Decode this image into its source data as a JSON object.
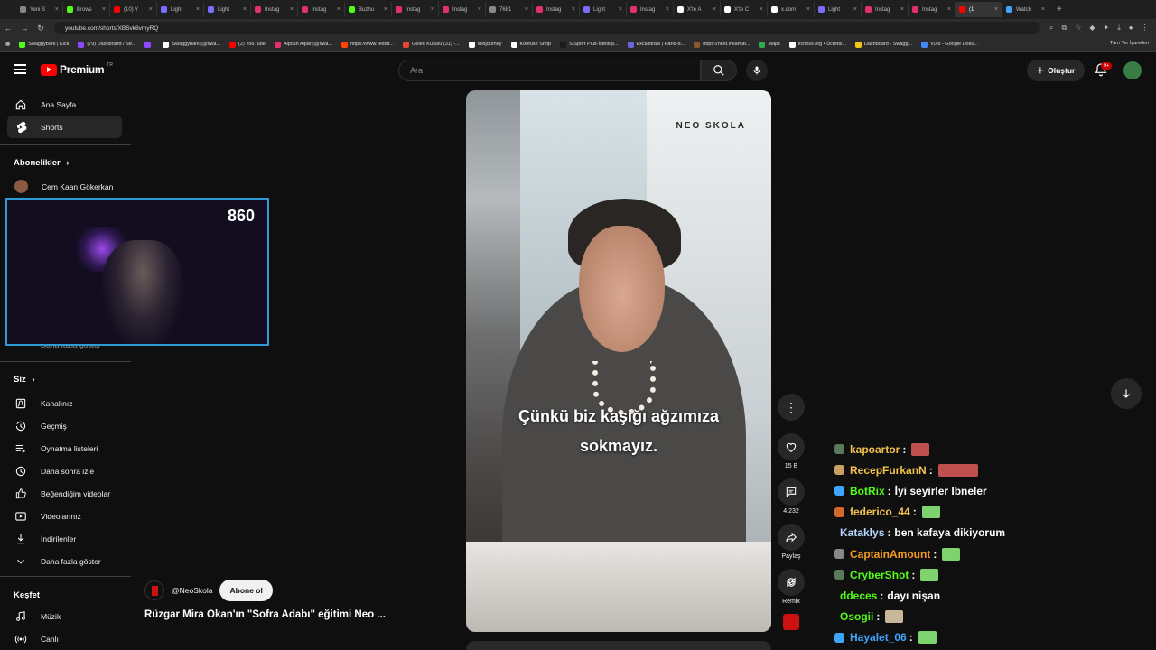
{
  "browser": {
    "tabs": [
      {
        "label": "Yeni S",
        "color": "#888888"
      },
      {
        "label": "Brows",
        "color": "#53fc18"
      },
      {
        "label": "(10) Y",
        "color": "#ff0000"
      },
      {
        "label": "Light",
        "color": "#7a6cff"
      },
      {
        "label": "Light",
        "color": "#7a6cff"
      },
      {
        "label": "Instag",
        "color": "#e1306c"
      },
      {
        "label": "Instag",
        "color": "#e1306c"
      },
      {
        "label": "Buzhu",
        "color": "#53fc18"
      },
      {
        "label": "Instag",
        "color": "#e1306c"
      },
      {
        "label": "Instag",
        "color": "#e1306c"
      },
      {
        "label": "7681",
        "color": "#888888"
      },
      {
        "label": "Instag",
        "color": "#e1306c"
      },
      {
        "label": "Light",
        "color": "#7a6cff"
      },
      {
        "label": "Instag",
        "color": "#e1306c"
      },
      {
        "label": "X'te A",
        "color": "#ffffff"
      },
      {
        "label": "X'te C",
        "color": "#ffffff"
      },
      {
        "label": "x.com",
        "color": "#ffffff"
      },
      {
        "label": "Light",
        "color": "#7a6cff"
      },
      {
        "label": "Instag",
        "color": "#e1306c"
      },
      {
        "label": "Instag",
        "color": "#e1306c"
      },
      {
        "label": "(1",
        "color": "#ff0000",
        "active": true
      },
      {
        "label": "Watch",
        "color": "#3ea6ff"
      }
    ],
    "url": "youtube.com/shorts/XBSvk8vmyRQ",
    "bookmarks": [
      {
        "label": "Swaggybark | Kick",
        "color": "#53fc18"
      },
      {
        "label": "(79) Dashboard / Str...",
        "color": "#9146ff"
      },
      {
        "label": "",
        "color": "#9146ff"
      },
      {
        "label": "Swaggybark (@swa...",
        "color": "#ffffff"
      },
      {
        "label": "(2) YouTube",
        "color": "#ff0000"
      },
      {
        "label": "Alpcan Alpar (@swa...",
        "color": "#e1306c"
      },
      {
        "label": "https://www.reddit...",
        "color": "#ff4500"
      },
      {
        "label": "Gelen Kutusu (31) -...",
        "color": "#ea4335"
      },
      {
        "label": "Midjourney",
        "color": "#ffffff"
      },
      {
        "label": "Konfuse Shop",
        "color": "#ffffff"
      },
      {
        "label": "S Sport Plus-İstediği...",
        "color": "#1a1a1a"
      },
      {
        "label": "Excalidraw | Hand-d...",
        "color": "#6965db"
      },
      {
        "label": "https://next.inkamat...",
        "color": "#8b5a2b"
      },
      {
        "label": "Maps",
        "color": "#34a853"
      },
      {
        "label": "lichess.org • Ücretsi...",
        "color": "#ffffff"
      },
      {
        "label": "Dashboard - Swagg...",
        "color": "#f5c518"
      },
      {
        "label": "V0.8 - Google Dokü...",
        "color": "#4285f4"
      }
    ],
    "bookmarks_all": "Tüm Yer İşaretleri"
  },
  "header": {
    "logo_text": "Premium",
    "logo_region": "TR",
    "search_placeholder": "Ara",
    "create_label": "Oluştur",
    "notif_count": "9+"
  },
  "sidebar": {
    "items_top": [
      {
        "label": "Ana Sayfa",
        "icon": "home-icon"
      },
      {
        "label": "Shorts",
        "icon": "shorts-icon",
        "active": true
      }
    ],
    "subs_heading": "Abonelikler",
    "subs": [
      {
        "label": "Cem Kaan Gökerkan"
      }
    ],
    "show_more_hidden": "Daha fazla göster",
    "you_heading": "Siz",
    "you_items": [
      {
        "label": "Kanalınız",
        "icon": "channel-icon"
      },
      {
        "label": "Geçmiş",
        "icon": "history-icon"
      },
      {
        "label": "Oynatma listeleri",
        "icon": "playlists-icon"
      },
      {
        "label": "Daha sonra izle",
        "icon": "watch-later-icon"
      },
      {
        "label": "Beğendiğim videolar",
        "icon": "liked-icon"
      },
      {
        "label": "Videolarınız",
        "icon": "your-videos-icon"
      },
      {
        "label": "İndirilenler",
        "icon": "downloads-icon"
      },
      {
        "label": "Daha fazla göster",
        "icon": "chevron-down-icon"
      }
    ],
    "explore_heading": "Keşfet",
    "explore_items": [
      {
        "label": "Müzik",
        "icon": "music-icon"
      },
      {
        "label": "Canlı",
        "icon": "live-icon"
      }
    ]
  },
  "stream_overlay": {
    "counter": "860"
  },
  "short": {
    "brand": "NEO SKOLA",
    "caption_line1": "Çünkü biz kaşığı ağzımıza",
    "caption_line2": "sokmayız.",
    "likes": "15 B",
    "comments": "4.232",
    "share_label": "Paylaş",
    "remix_label": "Remix",
    "channel": "@NeoSkola",
    "subscribe_label": "Abone ol",
    "title": "Rüzgar Mira Okan'ın \"Sofra Adabı\" eğitimi Neo ..."
  },
  "chat": [
    {
      "user": "kapoartor",
      "color": "#f2c14e",
      "badge": "#5a7a5a",
      "message": "",
      "emote": "#c0504d"
    },
    {
      "user": "RecepFurkanN",
      "color": "#f2c14e",
      "badge": "#c8a060",
      "message": "",
      "emote": "#c0504d",
      "wide": true
    },
    {
      "user": "BotRix",
      "color": "#53fc18",
      "badge": "#3ea6ff",
      "message": "İyi seyirler Ibneler",
      "emote": ""
    },
    {
      "user": "federico_44",
      "color": "#f2c14e",
      "badge": "#d46a2a",
      "message": "",
      "emote": "#7fd36f"
    },
    {
      "user": "Kataklys",
      "color": "#b8d8ff",
      "badge": "",
      "message": "ben kafaya dikiyorum",
      "emote": ""
    },
    {
      "user": "CaptainAmount",
      "color": "#f59a23",
      "badge": "#888888",
      "message": "",
      "emote": "#7fd36f"
    },
    {
      "user": "CryberShot",
      "color": "#53fc18",
      "badge": "#5a7a5a",
      "message": "",
      "emote": "#7fd36f"
    },
    {
      "user": "ddeces",
      "color": "#53fc18",
      "badge": "",
      "message": "dayı nişan",
      "emote": ""
    },
    {
      "user": "Osogii",
      "color": "#53fc18",
      "badge": "",
      "message": "",
      "emote": "#c8b89a"
    },
    {
      "user": "Hayalet_06",
      "color": "#3ea6ff",
      "badge": "#3ea6ff",
      "message": "",
      "emote": "#7fd36f"
    }
  ]
}
